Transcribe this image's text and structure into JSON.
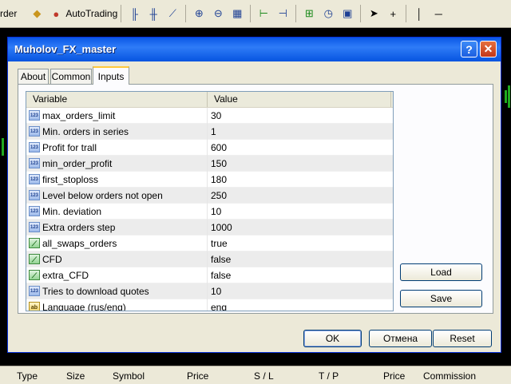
{
  "toolbar": {
    "order_partial": "rder",
    "autotrading_label": "AutoTrading"
  },
  "dialog": {
    "title": "Muholov_FX_master",
    "help_glyph": "?",
    "close_glyph": "✕",
    "tabs": [
      {
        "label": "About",
        "active": false
      },
      {
        "label": "Common",
        "active": false
      },
      {
        "label": "Inputs",
        "active": true
      }
    ],
    "table": {
      "headers": {
        "variable": "Variable",
        "value": "Value"
      },
      "rows": [
        {
          "type": "int",
          "variable": "max_orders_limit",
          "value": "30"
        },
        {
          "type": "int",
          "variable": "Min. orders in series",
          "value": "1"
        },
        {
          "type": "int",
          "variable": "Profit for trall",
          "value": "600"
        },
        {
          "type": "int",
          "variable": "min_order_profit",
          "value": "150"
        },
        {
          "type": "int",
          "variable": "first_stoploss",
          "value": "180"
        },
        {
          "type": "int",
          "variable": "Level below orders not open",
          "value": "250"
        },
        {
          "type": "int",
          "variable": "Min. deviation",
          "value": "10"
        },
        {
          "type": "int",
          "variable": "Extra orders step",
          "value": "1000"
        },
        {
          "type": "bool",
          "variable": "all_swaps_orders",
          "value": "true"
        },
        {
          "type": "bool",
          "variable": "CFD",
          "value": "false"
        },
        {
          "type": "bool",
          "variable": "extra_CFD",
          "value": "false"
        },
        {
          "type": "int",
          "variable": "Tries to download quotes",
          "value": "10"
        },
        {
          "type": "string",
          "variable": "Language (rus/eng)",
          "value": "eng"
        }
      ]
    },
    "buttons": {
      "load": "Load",
      "save": "Save",
      "ok": "OK",
      "cancel": "Отмена",
      "reset": "Reset"
    }
  },
  "terminal": {
    "columns": [
      "Type",
      "Size",
      "Symbol",
      "Price",
      "S / L",
      "T / P",
      "Price",
      "Commission"
    ]
  },
  "colors": {
    "titlebar": "#0a58e6",
    "chart_background": "#000000",
    "chart_candles": "#1faa1f"
  }
}
